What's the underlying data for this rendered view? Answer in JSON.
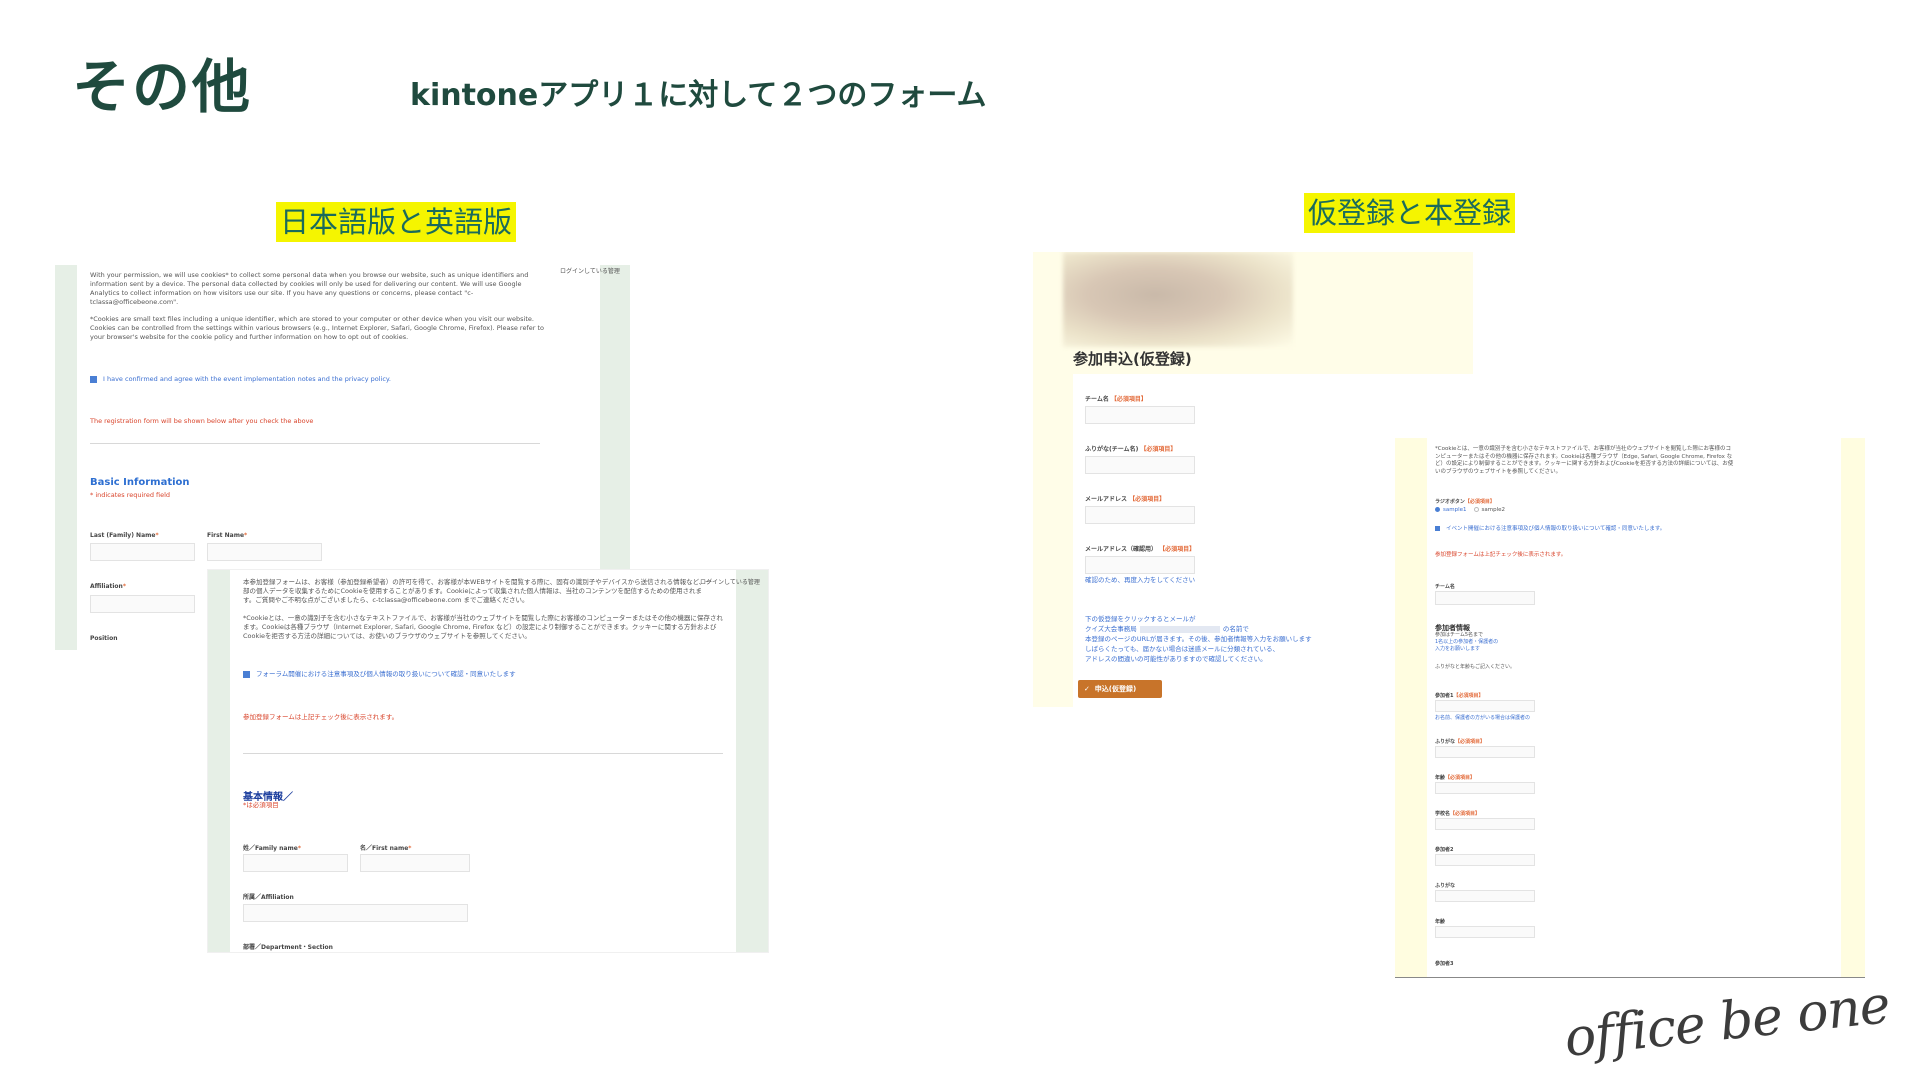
{
  "slide": {
    "title": "その他",
    "subtitle": "kintoneアプリ１に対して２つのフォーム",
    "left_caption": "日本語版と英語版",
    "right_caption": "仮登録と本登録",
    "logo": "office be one"
  },
  "en_form": {
    "login_note": "ログインしている管理",
    "intro": "With your permission, we will use cookies* to collect some personal data when you browse our website, such as unique identifiers and information sent by a device. The personal data collected by cookies will only be used for delivering our content. We will use Google Analytics to collect information on how visitors use our site. If you have any questions or concerns, please contact \"c-tclassa@officebeone.com\".",
    "cookie_note": "*Cookies are small text files including a unique identifier, which are stored to your computer or other device when you visit our website. Cookies can be controlled from the settings within various browsers (e.g., Internet Explorer, Safari, Google Chrome, Firefox). Please refer to your browser's website for the cookie policy and further information on how to opt out of cookies.",
    "consent": "I have confirmed and agree with the event implementation notes and the privacy policy.",
    "notice": "The registration form will be shown below after you check the above",
    "section": "Basic Information",
    "required_note": "* indicates required field",
    "last_name": "Last (Family) Name",
    "first_name": "First Name",
    "affiliation": "Affiliation",
    "position": "Position"
  },
  "jp_form": {
    "login_note": "ログインしている管理",
    "intro": "本参加登録フォームは、お客様（参加登録希望者）の許可を得て、お客様が本WEBサイトを閲覧する際に、固有の識別子やデバイスから送信される情報など、一部の個人データを収集するためにCookieを使用することがあります。Cookieによって収集された個人情報は、当社のコンテンツを配信するための使用されます。ご質問やご不明な点がございましたら、c-tclassa@officebeone.com までご連絡ください。",
    "cookie_note": "*Cookieとは、一意の識別子を含む小さなテキストファイルで、お客様が当社のウェブサイトを閲覧した際にお客様のコンピューターまたはその他の機器に保存されます。Cookieは各種ブラウザ（Internet Explorer, Safari, Google Chrome, Firefox など）の設定により制御することができます。クッキーに関する方針およびCookieを拒否する方法の詳細については、お使いのブラウザのウェブサイトを参照してください。",
    "consent": "フォーラム開催における注意事項及び個人情報の取り扱いについて確認・同意いたします",
    "notice": "参加登録フォームは上記チェック後に表示されます。",
    "section": "基本情報／",
    "required_note": "*は必須項目",
    "last_name": "姓／Family name",
    "first_name": "名／First name",
    "affiliation": "所属／Affiliation",
    "department": "部署／Department・Section"
  },
  "pre_form": {
    "heading": "参加申込(仮登録)",
    "required_tag": "【必須項目】",
    "team_name": "チーム名",
    "team_kana": "ふりがな(チーム名)",
    "email": "メールアドレス",
    "email_confirm": "メールアドレス（確認用）",
    "confirm_hint": "確認のため、再度入力をしてください",
    "info_1": "下の仮登録をクリックするとメールが",
    "info_2": "クイズ大会事務局",
    "info_3": "の名前で",
    "info_4": "本登録のページのURLが届きます。その後、参加者情報等入力をお願いします",
    "info_5": "しばらくたっても、届かない場合は迷惑メールに分類されている、",
    "info_6": "アドレスの間違いの可能性がありますので確認してください。",
    "submit": "申込(仮登録)"
  },
  "main_form": {
    "cookie_text": "*Cookieとは、一意の識別子を含む小さなテキストファイルで、お客様が当社のウェブサイトを閲覧した際にお客様のコンピューターまたはその他の機器に保存されます。Cookieは各種ブラウザ（Edge, Safari, Google Chrome, Firefox など）の設定により制御することができます。クッキーに関する方針およびCookieを拒否する方法の詳細については、お使いのブラウザのウェブサイトを参照してください。",
    "radio_label": "ラジオボタン",
    "radio_opt1": "sample1",
    "radio_opt2": "sample2",
    "consent": "イベント開催における注意事項及び個人情報の取り扱いについて確認・同意いたします。",
    "notice": "参加登録フォームは上記チェック後に表示されます。",
    "team_name": "チーム名",
    "section": "参加者情報",
    "section_note_1": "参加はチーム5名まで",
    "section_note_2": "1名以上の参加者・保護者の",
    "section_note_3": "入力をお願いします",
    "kana_note": "ふりがなと年齢もご記入ください。",
    "p1": "参加者1",
    "p1_note": "お名前、保護者の方がいる場合は保護者の",
    "p1_kana": "ふりがな",
    "p1_age": "年齢",
    "p1_school": "学校名",
    "p2": "参加者2",
    "p2_kana": "ふりがな",
    "p2_age": "年齢",
    "p3": "参加者3"
  }
}
